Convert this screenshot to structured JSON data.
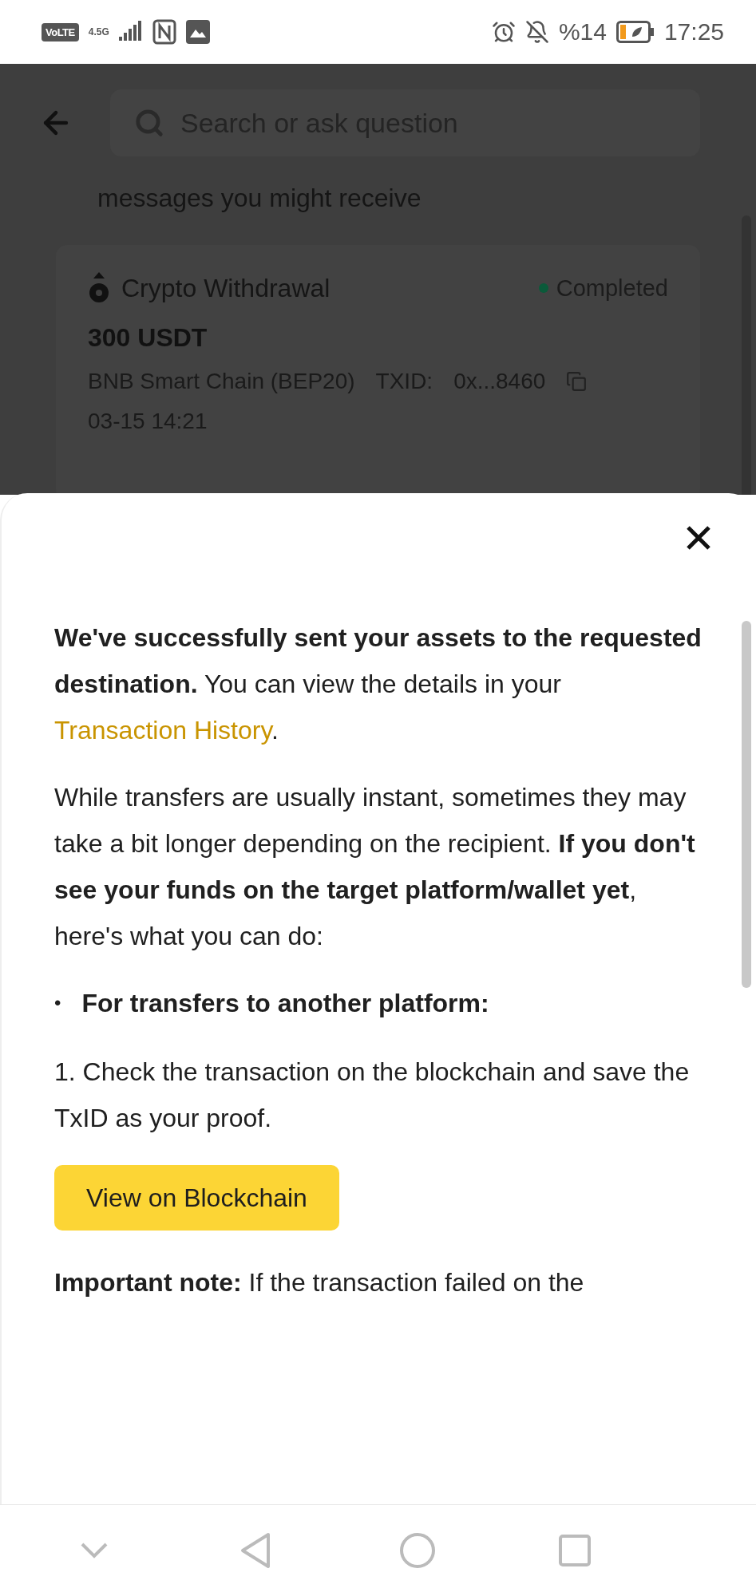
{
  "status_bar": {
    "volte": "VoLTE",
    "network": "4.5G",
    "battery": "%14",
    "time": "17:25"
  },
  "background_page": {
    "search": {
      "placeholder": "Search or ask question"
    },
    "heading": "messages you might receive",
    "card": {
      "title": "Crypto Withdrawal",
      "status": "Completed",
      "amount": "300 USDT",
      "network": "BNB Smart Chain (BEP20)",
      "txid_label": "TXID:",
      "txid": "0x...8460",
      "time": "03-15 14:21"
    }
  },
  "sheet": {
    "blocks": [
      {
        "kind": "paragraph",
        "text": "**We've successfully sent your assets to the requested destination.** You can view the details in your ",
        "link": "Transaction History",
        "after": "."
      },
      {
        "kind": "paragraph",
        "text": "While transfers are usually instant, sometimes they may take a bit longer depending on the recipient. **If you don't see your funds on the target platform/wallet yet**, here's what you can do:"
      },
      {
        "kind": "bullet",
        "marker": "•",
        "text": "For transfers to another platform:"
      },
      {
        "kind": "paragraph",
        "text": "1. Check the transaction on the blockchain and save the TxID as your proof."
      },
      {
        "kind": "button",
        "label": "View on Blockchain"
      },
      {
        "kind": "paragraph",
        "text": "**Important note:** If the transaction failed on the"
      }
    ]
  }
}
